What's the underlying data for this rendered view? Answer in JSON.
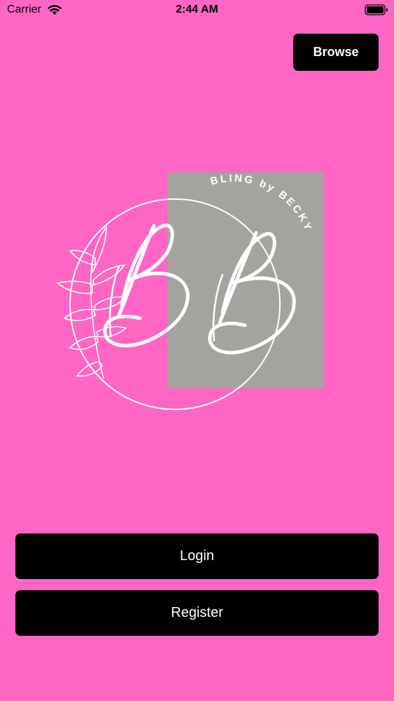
{
  "status_bar": {
    "carrier": "Carrier",
    "time": "2:44 AM",
    "wifi_icon": "wifi-icon",
    "battery_icon": "battery-icon"
  },
  "header": {
    "browse_label": "Browse"
  },
  "logo": {
    "brand_text": "BLING by BECKY",
    "icon": "bling-by-becky-logo"
  },
  "actions": {
    "login_label": "Login",
    "register_label": "Register"
  },
  "colors": {
    "background": "#ff66c4",
    "button": "#000000",
    "button_text": "#ffffff",
    "logo_panel": "#a3a49f",
    "logo_line": "#ffffff"
  }
}
